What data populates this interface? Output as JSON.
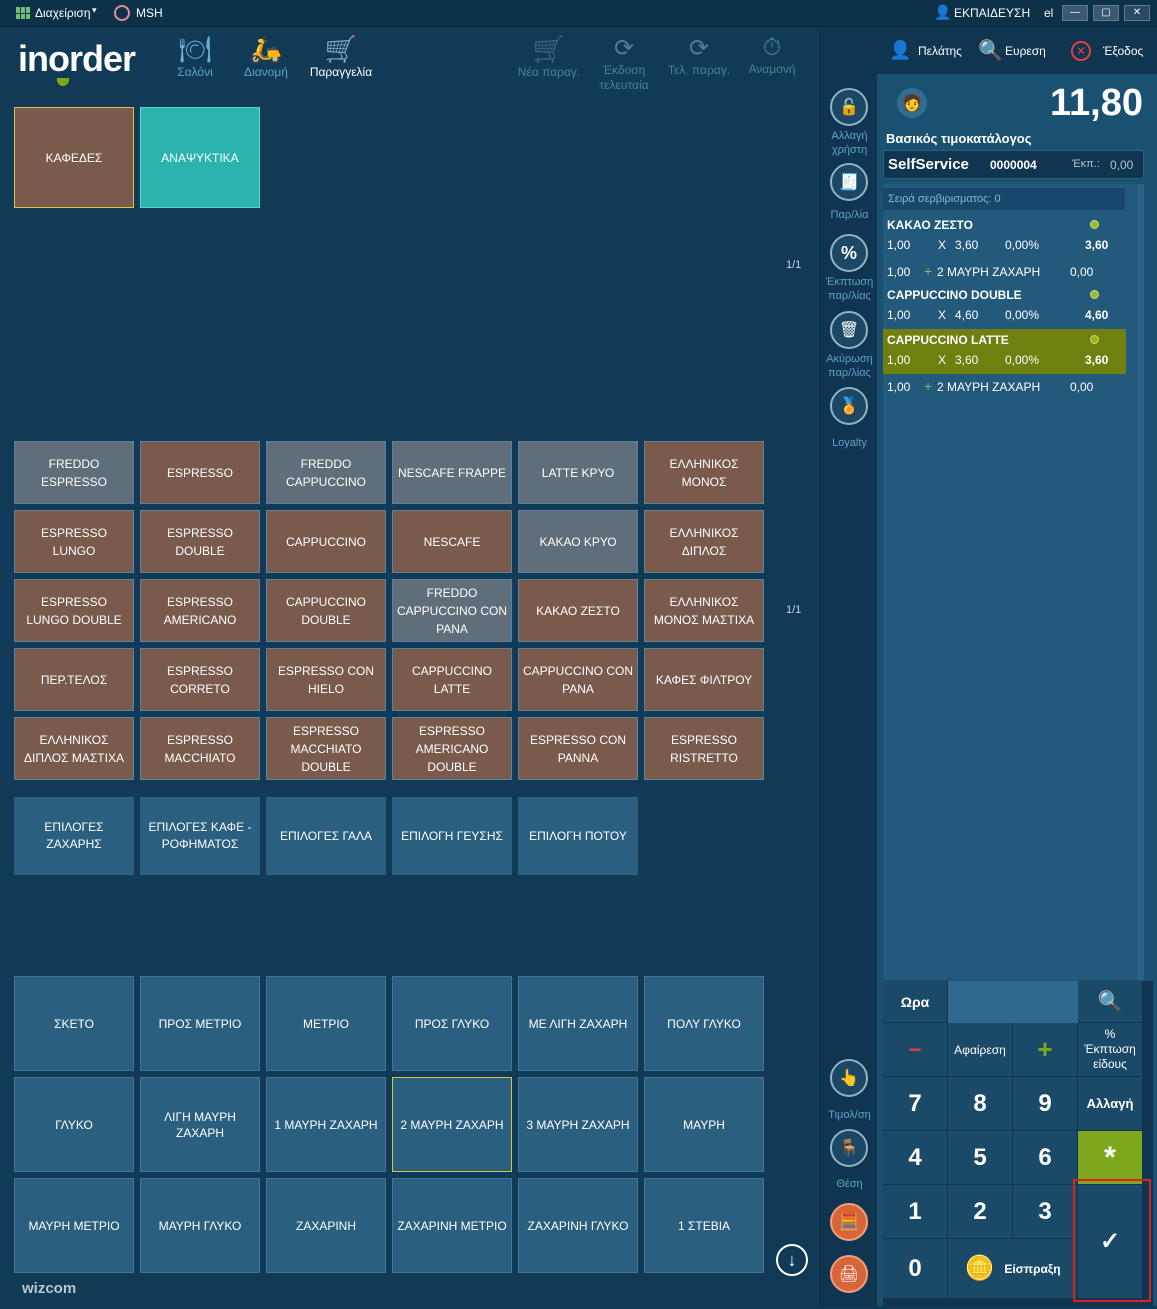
{
  "titlebar": {
    "menu": "Διαχείριση",
    "brand": "MSH",
    "user": "ΕΚΠΑΙΔΕΥΣΗ",
    "lang": "el"
  },
  "logo": {
    "text": "inorder",
    "footer": "wizcom"
  },
  "nav": {
    "salon": "Σαλόνι",
    "delivery": "Διανομή",
    "order": "Παραγγελία",
    "new_order": "Νέα παραγ.",
    "issue_last": "Έκδοση τελευταία",
    "end_order": "Τελ. παραγ.",
    "wait": "Αναμονή"
  },
  "categories": [
    "ΚΑΦΕΔΕΣ",
    "ΑΝΑΨΥΚΤΙΚΑ"
  ],
  "pagers": {
    "categories": "1/1",
    "products": "1/1"
  },
  "products": [
    {
      "label": "FREDDO ESPRESSO",
      "c": "grey"
    },
    {
      "label": "ESPRESSO",
      "c": "brown"
    },
    {
      "label": "FREDDO CAPPUCCINO",
      "c": "grey"
    },
    {
      "label": "NESCAFE FRAPPE",
      "c": "grey"
    },
    {
      "label": "LATTE ΚΡΥΟ",
      "c": "grey"
    },
    {
      "label": "ΕΛΛΗΝΙΚΟΣ ΜΟΝΟΣ",
      "c": "brown"
    },
    {
      "label": "ESPRESSO LUNGO",
      "c": "brown"
    },
    {
      "label": "ESPRESSO DOUBLE",
      "c": "brown"
    },
    {
      "label": "CAPPUCCINO",
      "c": "brown"
    },
    {
      "label": "NESCAFE",
      "c": "brown"
    },
    {
      "label": "ΚΑΚΑΟ ΚΡΥΟ",
      "c": "grey"
    },
    {
      "label": "ΕΛΛΗΝΙΚΟΣ ΔΙΠΛΟΣ",
      "c": "brown"
    },
    {
      "label": "ESPRESSO LUNGO DOUBLE",
      "c": "brown"
    },
    {
      "label": "ESPRESSO AMERICANO",
      "c": "brown"
    },
    {
      "label": "CAPPUCCINO DOUBLE",
      "c": "brown"
    },
    {
      "label": "FREDDO CAPPUCCINO CON PANA",
      "c": "grey"
    },
    {
      "label": "ΚΑΚΑΟ ΖΕΣΤΟ",
      "c": "brown"
    },
    {
      "label": "ΕΛΛΗΝΙΚΟΣ ΜΟΝΟΣ ΜΑΣΤΙΧΑ",
      "c": "brown"
    },
    {
      "label": "ΠΕΡ.ΤΕΛΟΣ",
      "c": "brown"
    },
    {
      "label": "ESPRESSO CORRETO",
      "c": "brown"
    },
    {
      "label": "ESPRESSO CON HIELO",
      "c": "brown"
    },
    {
      "label": "CAPPUCCINO LATTE",
      "c": "brown"
    },
    {
      "label": "CAPPUCCINO CON PANA",
      "c": "brown"
    },
    {
      "label": "ΚΑΦΕΣ ΦΙΛΤΡΟΥ",
      "c": "brown"
    },
    {
      "label": "ΕΛΛΗΝΙΚΟΣ ΔΙΠΛΟΣ ΜΑΣΤΙΧΑ",
      "c": "brown"
    },
    {
      "label": "ESPRESSO MACCHIATO",
      "c": "brown"
    },
    {
      "label": "ESPRESSO MACCHIATO DOUBLE",
      "c": "brown"
    },
    {
      "label": "ESPRESSO AMERICANO DOUBLE",
      "c": "brown"
    },
    {
      "label": "ESPRESSO CON PANNA",
      "c": "brown"
    },
    {
      "label": "ESPRESSO RISTRETTO",
      "c": "brown"
    }
  ],
  "options": [
    "ΕΠΙΛΟΓΕΣ ΖΑΧΑΡΗΣ",
    "ΕΠΙΛΟΓΕΣ ΚΑΦΕ - ΡΟΦΗΜΑΤΟΣ",
    "ΕΠΙΛΟΓΕΣ ΓΑΛΑ",
    "ΕΠΙΛΟΓΗ ΓΕΥΣΗΣ",
    "ΕΠΙΛΟΓΗ ΠΟΤΟΥ"
  ],
  "suggestions": [
    "ΣΚΕΤΟ",
    "ΠΡΟΣ ΜΕΤΡΙΟ",
    "ΜΕΤΡΙΟ",
    "ΠΡΟΣ ΓΛΥΚΟ",
    "ΜΕ ΛΙΓΗ ΖΑΧΑΡΗ",
    "ΠΟΛΥ ΓΛΥΚΟ",
    "ΓΛΥΚΟ",
    "ΛΙΓΗ ΜΑΥΡΗ ΖΑΧΑΡΗ",
    "1 ΜΑΥΡΗ ΖΑΧΑΡΗ",
    "2 ΜΑΥΡΗ ΖΑΧΑΡΗ",
    "3 ΜΑΥΡΗ ΖΑΧΑΡΗ",
    "ΜΑΥΡΗ",
    "ΜΑΥΡΗ ΜΕΤΡΙΟ",
    "ΜΑΥΡΗ ΓΛΥΚΟ",
    "ΖΑΧΑΡΙΝΗ",
    "ΖΑΧΑΡΙΝΗ ΜΕΤΡΙΟ",
    "ΖΑΧΑΡΙΝΗ ΓΛΥΚΟ",
    "1 ΣΤΕΒΙΑ"
  ],
  "mid": {
    "change_user": "Αλλαγή χρήστη",
    "doc": "Παρ/λία",
    "discount": "Έκπτωση παρ/λίας",
    "cancel": "Ακύρωση παρ/λίας",
    "loyalty": "Loyalty",
    "invoice": "Τιμολ/ση",
    "seat": "Θέση"
  },
  "right": {
    "customer": "Πελάτης",
    "search": "Ευρεση",
    "exit": "Έξοδος",
    "total": "11,80",
    "pricelist": "Βασικός τιμοκατάλογος",
    "station": "SelfService",
    "doc_no": "0000004",
    "disc_label": "Έκπ.:",
    "disc_value": "0,00",
    "serve_order": "Σειρά σερβιρισματος: 0",
    "lines": [
      {
        "name": "ΚΑΚΑΟ ΖΕΣΤΟ",
        "qty": "1,00",
        "x": "X",
        "price": "3,60",
        "disc": "0,00%",
        "total": "3,60",
        "sel": false
      },
      {
        "extra": true,
        "qty": "1,00",
        "plus": "+",
        "name": "2 ΜΑΥΡΗ ΖΑΧΑΡΗ",
        "total": "0,00"
      },
      {
        "name": "CAPPUCCINO DOUBLE",
        "qty": "1,00",
        "x": "X",
        "price": "4,60",
        "disc": "0,00%",
        "total": "4,60",
        "sel": false
      },
      {
        "name": "CAPPUCCINO LATTE",
        "qty": "1,00",
        "x": "X",
        "price": "3,60",
        "disc": "0,00%",
        "total": "3,60",
        "sel": true
      },
      {
        "extra": true,
        "qty": "1,00",
        "plus": "+",
        "name": "2 ΜΑΥΡΗ ΖΑΧΑΡΗ",
        "total": "0,00"
      }
    ],
    "keypad": {
      "time": "Ωρα",
      "minus": "−",
      "remove": "Αφαίρεση",
      "plus": "+",
      "item_disc": "% Έκπτωση είδους",
      "change": "Αλλαγή",
      "star": "*",
      "pay": "Είσπραξη",
      "check": "✓",
      "digits": [
        "7",
        "8",
        "9",
        "4",
        "5",
        "6",
        "1",
        "2",
        "3",
        "0"
      ]
    }
  },
  "colors": {
    "brown": "#7a5a4c",
    "grey": "#5f6e7a",
    "teal": "#2bb3b0",
    "selected": "#6f7f10",
    "accent_green": "#7da81e",
    "highlight_red": "#e02020"
  }
}
